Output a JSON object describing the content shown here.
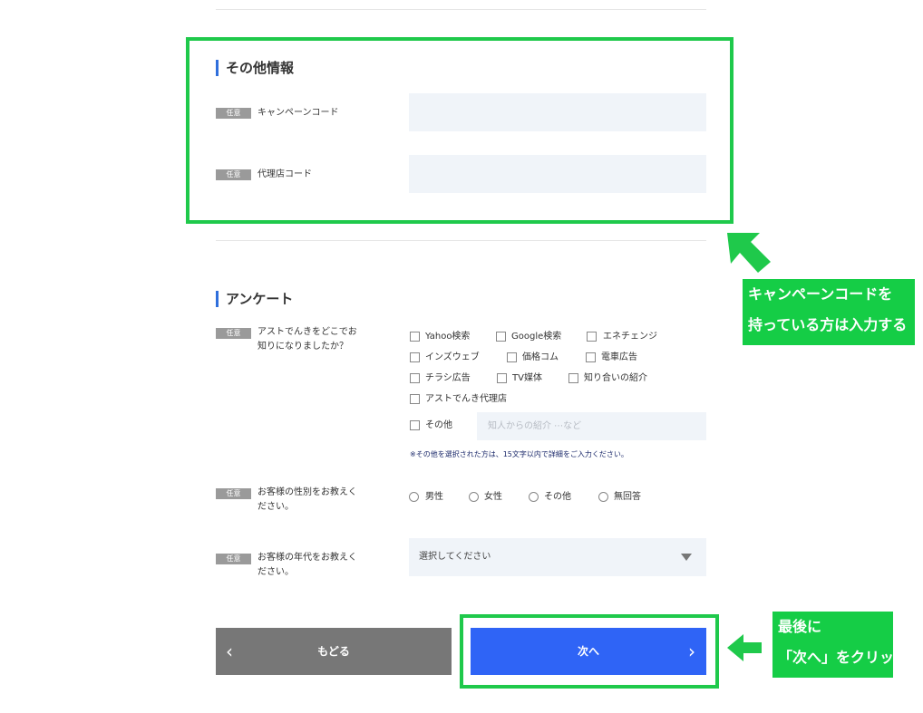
{
  "other_info": {
    "title": "その他情報",
    "fields": [
      {
        "badge": "任意",
        "label": "キャンペーンコード",
        "value": ""
      },
      {
        "badge": "任意",
        "label": "代理店コード",
        "value": ""
      }
    ]
  },
  "survey": {
    "title": "アンケート",
    "q1": {
      "badge": "任意",
      "label_line1": "アストでんきをどこでお",
      "label_line2": "知りになりましたか？",
      "options": [
        "Yahoo検索",
        "Google検索",
        "エネチェンジ",
        "インズウェブ",
        "価格コム",
        "電車広告",
        "チラシ広告",
        "TV媒体",
        "知り合いの紹介",
        "アストでんき代理店",
        "その他"
      ],
      "other_placeholder": "知人からの紹介 ⋯など",
      "note": "※その他を選択された方は、15文字以内で詳細をご入力ください。"
    },
    "q2": {
      "badge": "任意",
      "label_line1": "お客様の性別をお教えく",
      "label_line2": "ださい。",
      "options": [
        "男性",
        "女性",
        "その他",
        "無回答"
      ]
    },
    "q3": {
      "badge": "任意",
      "label_line1": "お客様の年代をお教えく",
      "label_line2": "ださい。",
      "selected": "選択してください"
    }
  },
  "buttons": {
    "back": "もどる",
    "next": "次へ"
  },
  "icons": {
    "back_chevron": "‹",
    "next_chevron": "›"
  },
  "annotations": {
    "campaign_line1": "キャンペーンコードを",
    "campaign_line2": "持っている方は入力する",
    "next_line1": "最後に",
    "next_line2": "「次へ」をクリック"
  },
  "colors": {
    "accent": "#2f64f6",
    "annotation_green": "#1fc94b",
    "back_button": "#777777",
    "input_bg": "#f0f4f9"
  }
}
